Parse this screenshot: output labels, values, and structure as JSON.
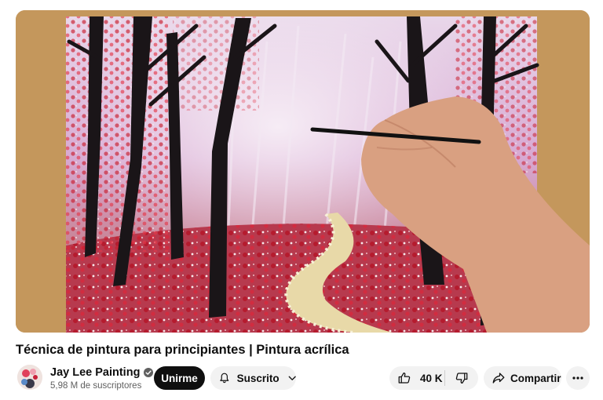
{
  "video": {
    "title": "Técnica de pintura para principiantes | Pintura acrílica",
    "thumbnail_subject": "acrylic painting of a pink forest path with red blossom dots, hand holding a brush"
  },
  "channel": {
    "name": "Jay Lee Painting",
    "verified": true,
    "subscribers": "5,98 M de suscriptores"
  },
  "actions": {
    "join_label": "Unirme",
    "subscribed_label": "Suscrito",
    "like_count": "40 K",
    "share_label": "Compartir"
  },
  "icons": {
    "verified": "verified-check-icon",
    "bell": "bell-icon",
    "chevron": "chevron-down-icon",
    "like": "thumbs-up-icon",
    "dislike": "thumbs-down-icon",
    "share": "share-arrow-icon",
    "more": "more-dots-icon"
  },
  "colors": {
    "join_bg": "#0f0f0f",
    "pill_bg": "#f2f2f2",
    "secondary_text": "#606060"
  }
}
